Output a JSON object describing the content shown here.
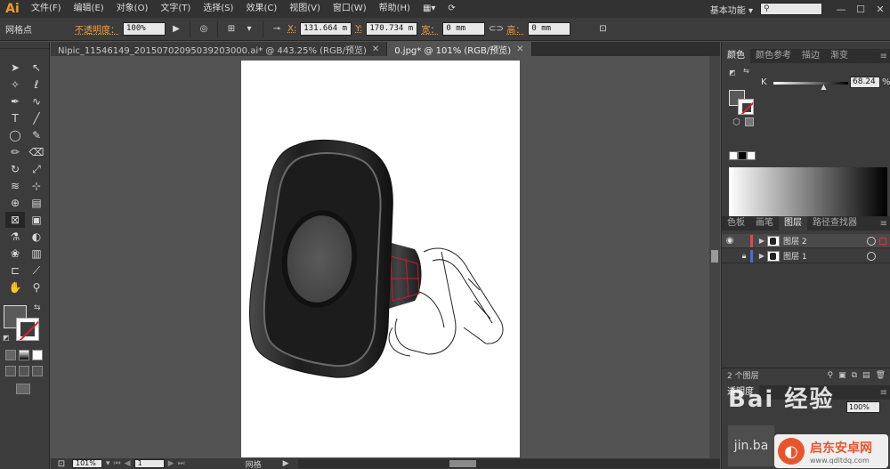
{
  "app": {
    "logo": "Ai",
    "menu": [
      "文件(F)",
      "编辑(E)",
      "对象(O)",
      "文字(T)",
      "选择(S)",
      "效果(C)",
      "视图(V)",
      "窗口(W)",
      "帮助(H)"
    ],
    "workspace": "基本功能",
    "window_controls": [
      "—",
      "☐",
      "✕"
    ]
  },
  "control_bar": {
    "selection_type": "网格点",
    "opacity_label": "不透明度：",
    "opacity_value": "100%",
    "x_label": "X:",
    "x_value": "131.664 m",
    "y_label": "Y:",
    "y_value": "170.734 m",
    "width_label": "宽：",
    "width_value": "0 mm",
    "height_label": "高：",
    "height_value": "0 mm"
  },
  "tabs": [
    {
      "label": "Nipic_11546149_20150702095039203000.ai* @ 443.25% (RGB/预览)",
      "active": false
    },
    {
      "label": "0.jpg* @ 101% (RGB/预览)",
      "active": true
    }
  ],
  "status_bar": {
    "zoom": "101%",
    "artboard": "1",
    "tool_name": "网格"
  },
  "color_panel": {
    "tabs": [
      "颜色",
      "颜色参考",
      "描边",
      "渐变"
    ],
    "active_tab": 0,
    "channel_label": "K",
    "channel_value": "68.24",
    "channel_unit": "%",
    "k_level": 0.6824
  },
  "layers_panel": {
    "tabs": [
      "色板",
      "画笔",
      "图层",
      "路径查找器"
    ],
    "active_tab": 2,
    "layers": [
      {
        "name": "图层 2",
        "color": "#e0484a",
        "selected": true
      },
      {
        "name": "图层 1",
        "color": "#4a6ed8",
        "selected": false
      }
    ],
    "count_label": "2 个图层"
  },
  "transparency_panel": {
    "tab": "透明度",
    "value": "100%"
  },
  "watermarks": {
    "baidu": "Bai 经验",
    "site_name": "启东安卓网",
    "site_url": "www.qdltdq.com",
    "corner": "jin.ba"
  },
  "colors": {
    "accent_orange": "#f39a28",
    "bg_dark": "#323232",
    "panel": "#3c3c3c",
    "canvas": "#535353"
  }
}
